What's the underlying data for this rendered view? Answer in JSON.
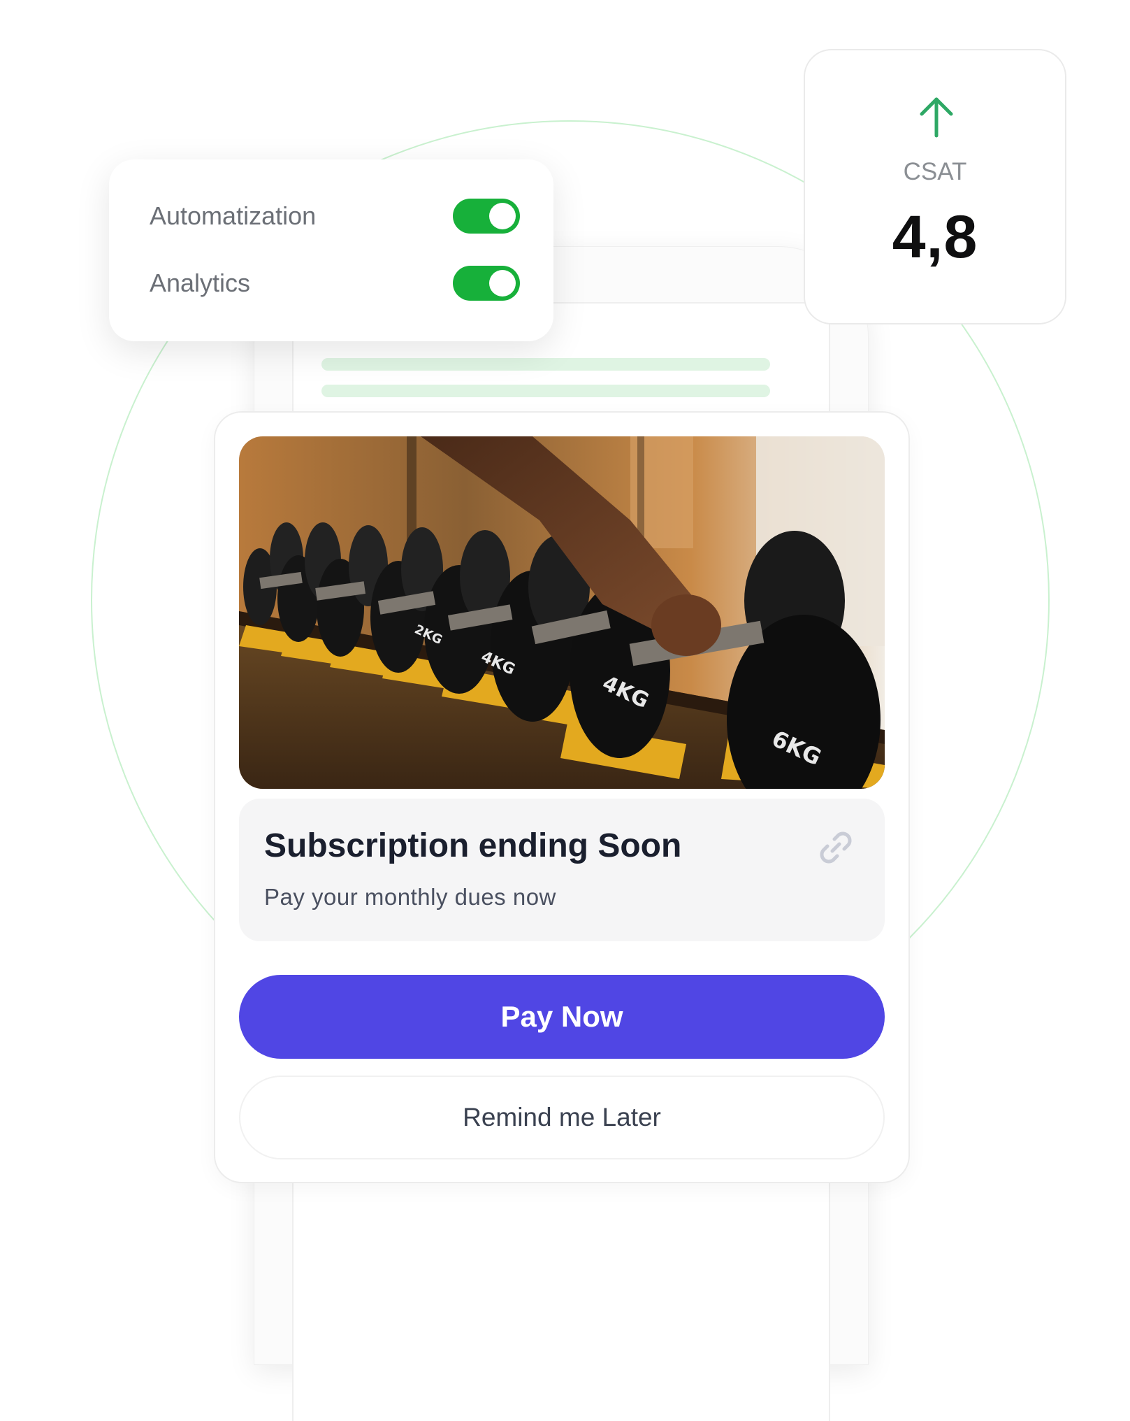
{
  "colors": {
    "toggle_on": "#17b03a",
    "csat_arrow": "#2ea865",
    "primary_button": "#5046e4",
    "ring": "#c9f1cf",
    "skeleton": "#dff4e3"
  },
  "settings_card": {
    "items": [
      {
        "label": "Automatization",
        "enabled": true
      },
      {
        "label": "Analytics",
        "enabled": true
      }
    ]
  },
  "csat_card": {
    "icon": "arrow-up-icon",
    "label": "CSAT",
    "value": "4,8"
  },
  "notification": {
    "image": "gym-dumbbells-photo",
    "title": "Subscription ending Soon",
    "subtitle": "Pay your monthly dues now",
    "link_icon": "link-icon",
    "primary_action": "Pay Now",
    "secondary_action": "Remind me Later"
  }
}
